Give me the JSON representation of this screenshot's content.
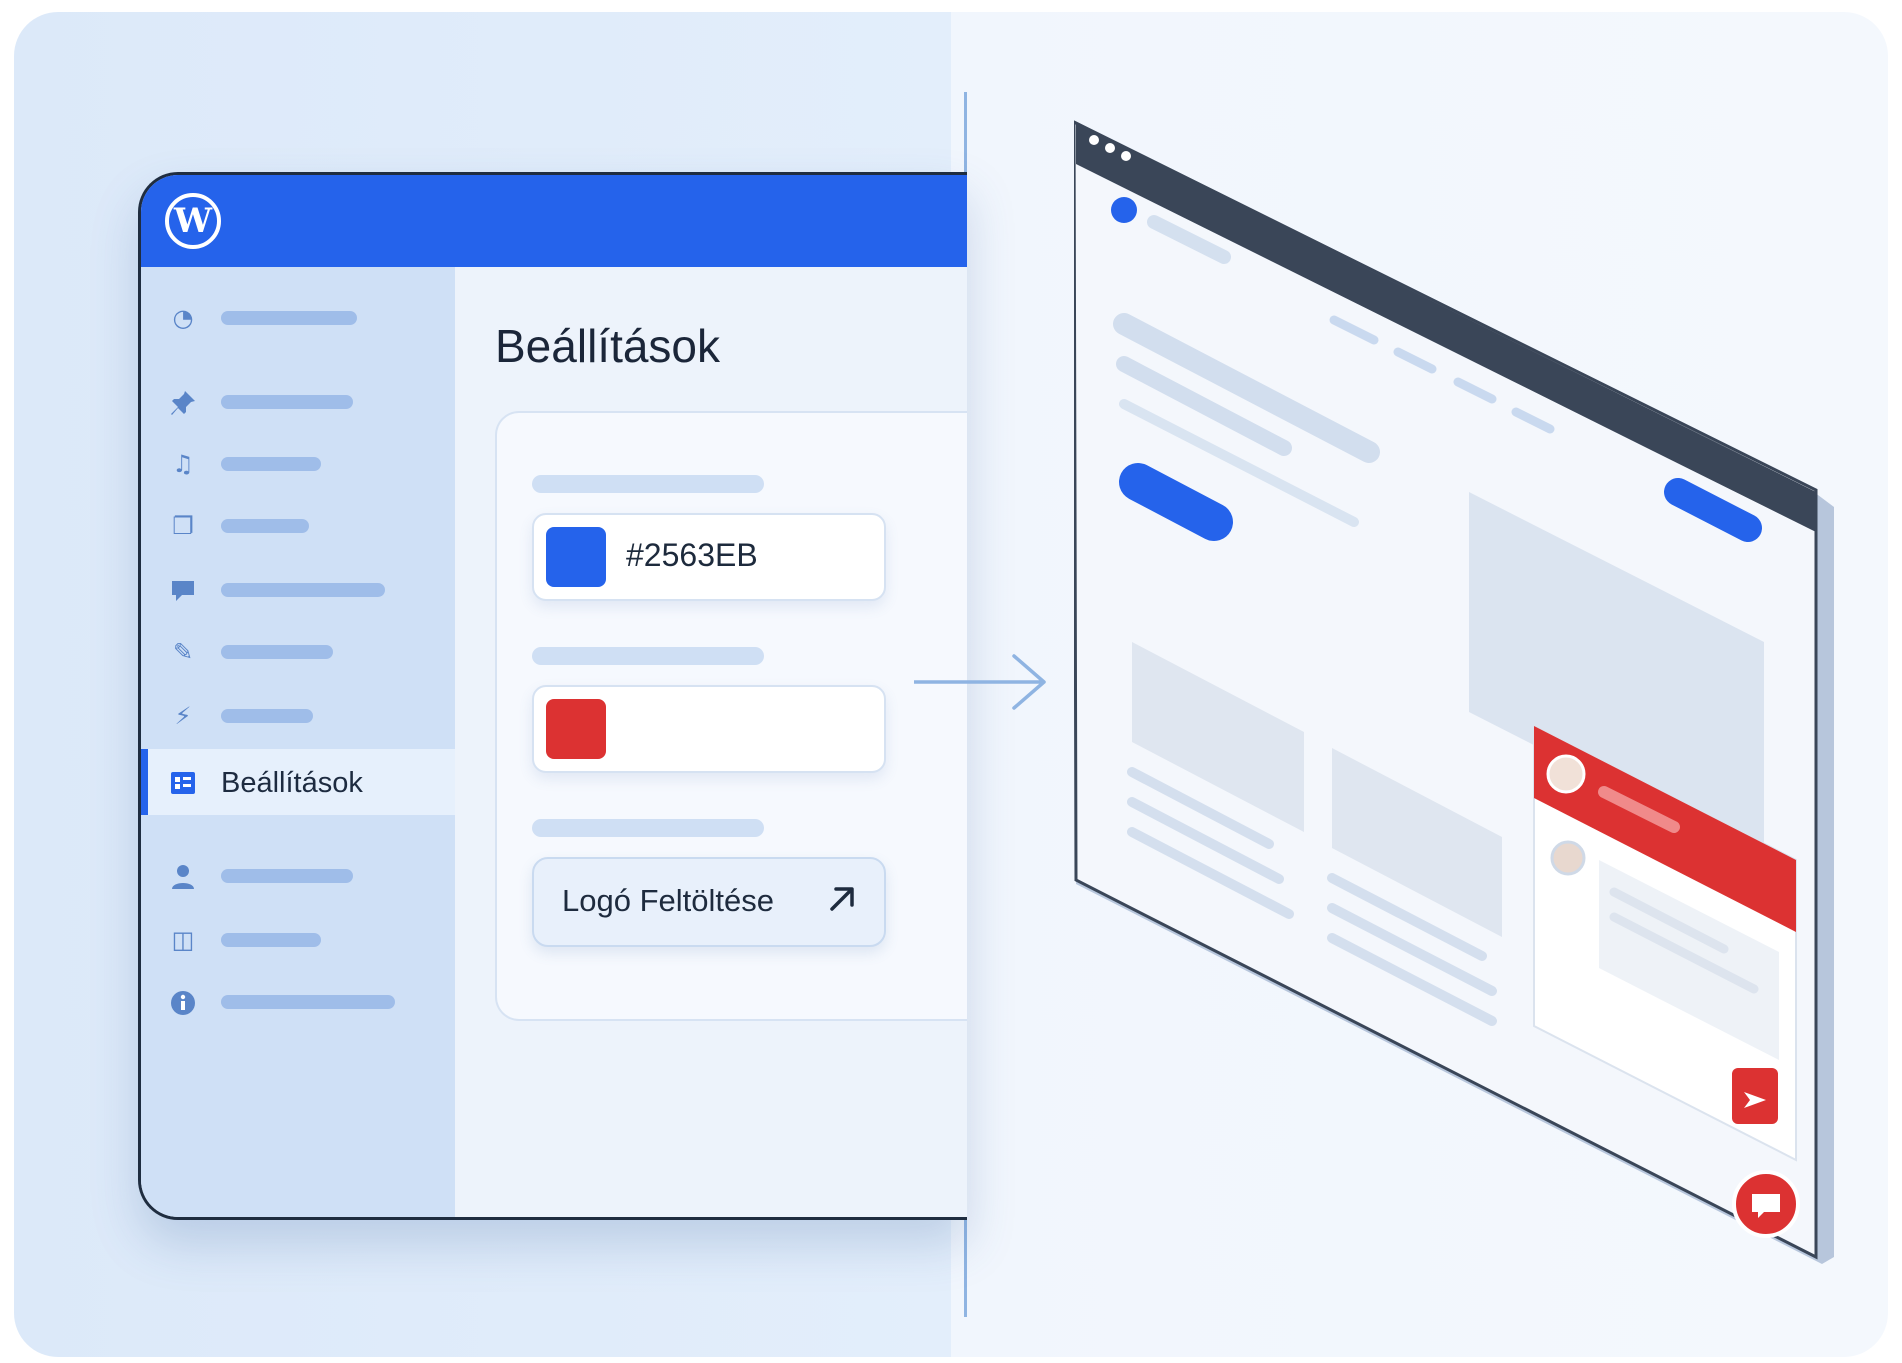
{
  "admin": {
    "page_title": "Beállítások",
    "sidebar": {
      "items": [
        {
          "icon": "dashboard-icon",
          "glyph": "◔",
          "active": false
        },
        {
          "icon": "pin-icon",
          "glyph": "📌",
          "active": false
        },
        {
          "icon": "media-icon",
          "glyph": "♫",
          "active": false
        },
        {
          "icon": "pages-icon",
          "glyph": "❐",
          "active": false
        },
        {
          "icon": "comments-icon",
          "glyph": "▰",
          "active": false
        },
        {
          "icon": "appearance-icon",
          "glyph": "✎",
          "active": false
        },
        {
          "icon": "plugins-icon",
          "glyph": "⚡",
          "active": false
        },
        {
          "icon": "settings-icon",
          "glyph": "▦",
          "active": true,
          "label": "Beállítások"
        },
        {
          "icon": "users-icon",
          "glyph": "●",
          "active": false
        },
        {
          "icon": "tools-icon",
          "glyph": "◫",
          "active": false
        },
        {
          "icon": "info-icon",
          "glyph": "ⓘ",
          "active": false
        }
      ]
    },
    "settings": {
      "primary_color": {
        "value": "#2563EB",
        "swatch": "#2563EB"
      },
      "secondary_color": {
        "value": "",
        "swatch": "#DC3232"
      },
      "upload_button": {
        "label": "Logó Feltöltése",
        "icon": "external-arrow-icon"
      }
    }
  },
  "colors": {
    "brand_blue": "#2563EB",
    "accent_red": "#DC3232",
    "frame_dark": "#3a4658"
  }
}
